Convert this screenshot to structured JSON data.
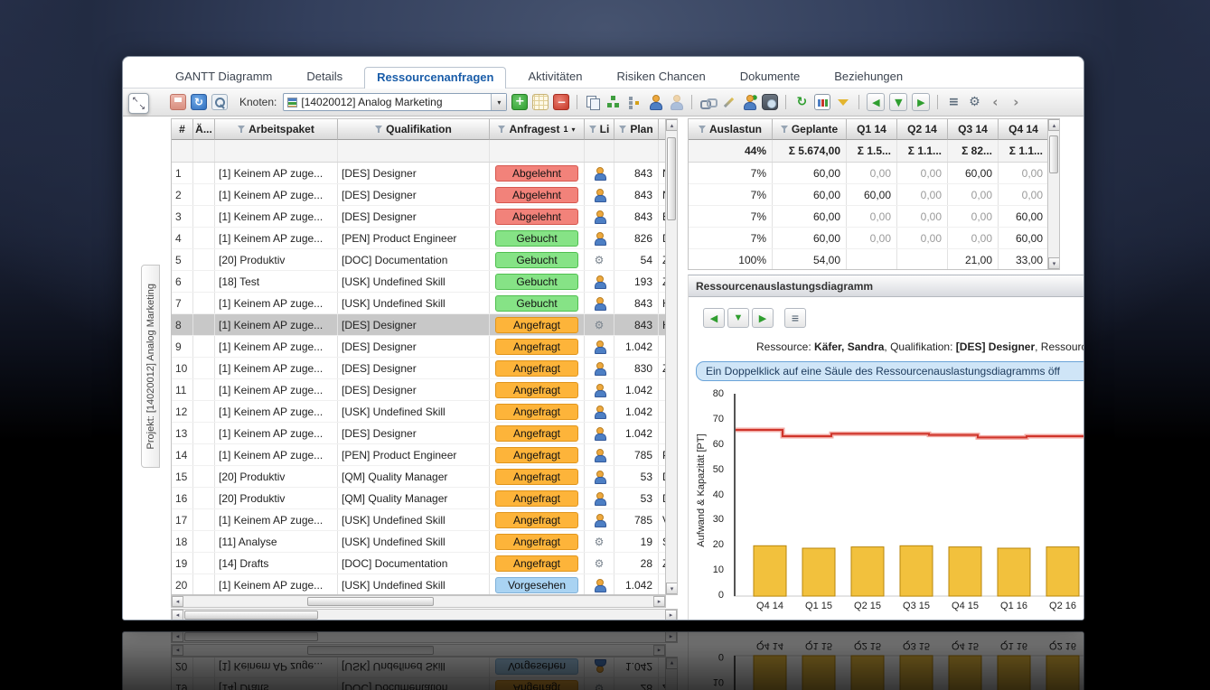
{
  "window": {
    "tabs": [
      {
        "label": "GANTT Diagramm",
        "active": false
      },
      {
        "label": "Details",
        "active": false
      },
      {
        "label": "Ressourcenanfragen",
        "active": true
      },
      {
        "label": "Aktivitäten",
        "active": false
      },
      {
        "label": "Risiken Chancen",
        "active": false
      },
      {
        "label": "Dokumente",
        "active": false
      },
      {
        "label": "Beziehungen",
        "active": false
      }
    ]
  },
  "project_tab": "Projekt: [14020012] Analog Marketing",
  "toolbar": {
    "knoten_label": "Knoten:",
    "node_value": "[14020012] Analog Marketing",
    "icons_left": [
      "save",
      "refresh",
      "zoom"
    ],
    "icons_right": [
      "add",
      "edit-grid",
      "remove",
      "divider",
      "copy",
      "org-tree",
      "tree",
      "person",
      "person-off",
      "divider",
      "link-edit",
      "wand",
      "person-add",
      "camera",
      "divider",
      "redo",
      "chart",
      "funnel",
      "divider",
      "nav-first",
      "nav-down",
      "nav-last",
      "divider",
      "tree-list",
      "gear",
      "overflow-prev",
      "overflow-next"
    ]
  },
  "requests_table": {
    "headers": {
      "num": "#",
      "aend": "Ä...",
      "ap": "Arbeitspaket",
      "qual": "Qualifikation",
      "status": "Anfragest",
      "sort": "1",
      "li": "Li",
      "plan": "Plan"
    },
    "status_colors": {
      "Abgelehnt": {
        "bg": "#f2827a",
        "border": "#d6564e"
      },
      "Gebucht": {
        "bg": "#86e386",
        "border": "#4fbf4f"
      },
      "Angefragt": {
        "bg": "#fdb43a",
        "border": "#e0951c"
      },
      "Vorgesehen": {
        "bg": "#a9d3f2",
        "border": "#7fb0d8"
      }
    },
    "rows": [
      {
        "num": "1",
        "ap": "[1] Keinem AP zuge...",
        "qual": "[DES] Designer",
        "status": "Abgelehnt",
        "icon": "person",
        "plan": "843",
        "extra": "N"
      },
      {
        "num": "2",
        "ap": "[1] Keinem AP zuge...",
        "qual": "[DES] Designer",
        "status": "Abgelehnt",
        "icon": "person",
        "plan": "843",
        "extra": "N"
      },
      {
        "num": "3",
        "ap": "[1] Keinem AP zuge...",
        "qual": "[DES] Designer",
        "status": "Abgelehnt",
        "icon": "person",
        "plan": "843",
        "extra": "E"
      },
      {
        "num": "4",
        "ap": "[1] Keinem AP zuge...",
        "qual": "[PEN] Product Engineer",
        "status": "Gebucht",
        "icon": "person",
        "plan": "826",
        "extra": "D"
      },
      {
        "num": "5",
        "ap": "[20] Produktiv",
        "qual": "[DOC] Documentation",
        "status": "Gebucht",
        "icon": "gear",
        "plan": "54",
        "extra": "Z"
      },
      {
        "num": "6",
        "ap": "[18] Test",
        "qual": "[USK] Undefined Skill",
        "status": "Gebucht",
        "icon": "person",
        "plan": "193",
        "extra": "Z"
      },
      {
        "num": "7",
        "ap": "[1] Keinem AP zuge...",
        "qual": "[USK] Undefined Skill",
        "status": "Gebucht",
        "icon": "person",
        "plan": "843",
        "extra": "H"
      },
      {
        "num": "8",
        "ap": "[1] Keinem AP zuge...",
        "qual": "[DES] Designer",
        "status": "Angefragt",
        "icon": "gear",
        "plan": "843",
        "extra": "H",
        "selected": true
      },
      {
        "num": "9",
        "ap": "[1] Keinem AP zuge...",
        "qual": "[DES] Designer",
        "status": "Angefragt",
        "icon": "person",
        "plan": "1.042",
        "extra": ""
      },
      {
        "num": "10",
        "ap": "[1] Keinem AP zuge...",
        "qual": "[DES] Designer",
        "status": "Angefragt",
        "icon": "person",
        "plan": "830",
        "extra": "Z"
      },
      {
        "num": "11",
        "ap": "[1] Keinem AP zuge...",
        "qual": "[DES] Designer",
        "status": "Angefragt",
        "icon": "person",
        "plan": "1.042",
        "extra": ""
      },
      {
        "num": "12",
        "ap": "[1] Keinem AP zuge...",
        "qual": "[USK] Undefined Skill",
        "status": "Angefragt",
        "icon": "person",
        "plan": "1.042",
        "extra": ""
      },
      {
        "num": "13",
        "ap": "[1] Keinem AP zuge...",
        "qual": "[DES] Designer",
        "status": "Angefragt",
        "icon": "person",
        "plan": "1.042",
        "extra": ""
      },
      {
        "num": "14",
        "ap": "[1] Keinem AP zuge...",
        "qual": "[PEN] Product Engineer",
        "status": "Angefragt",
        "icon": "person",
        "plan": "785",
        "extra": "P"
      },
      {
        "num": "15",
        "ap": "[20] Produktiv",
        "qual": "[QM] Quality Manager",
        "status": "Angefragt",
        "icon": "person",
        "plan": "53",
        "extra": "D"
      },
      {
        "num": "16",
        "ap": "[20] Produktiv",
        "qual": "[QM] Quality Manager",
        "status": "Angefragt",
        "icon": "person",
        "plan": "53",
        "extra": "D"
      },
      {
        "num": "17",
        "ap": "[1] Keinem AP zuge...",
        "qual": "[USK] Undefined Skill",
        "status": "Angefragt",
        "icon": "person",
        "plan": "785",
        "extra": "V"
      },
      {
        "num": "18",
        "ap": "[11] Analyse",
        "qual": "[USK] Undefined Skill",
        "status": "Angefragt",
        "icon": "gear",
        "plan": "19",
        "extra": "S"
      },
      {
        "num": "19",
        "ap": "[14] Drafts",
        "qual": "[DOC] Documentation",
        "status": "Angefragt",
        "icon": "gear",
        "plan": "28",
        "extra": "Z"
      },
      {
        "num": "20",
        "ap": "[1] Keinem AP zuge...",
        "qual": "[USK] Undefined Skill",
        "status": "Vorgesehen",
        "icon": "person",
        "plan": "1.042",
        "extra": ""
      }
    ]
  },
  "allocation_table": {
    "headers": [
      "Auslastun",
      "Geplante",
      "Q1 14",
      "Q2 14",
      "Q3 14",
      "Q4 14"
    ],
    "summary": [
      "44%",
      "Σ 5.674,00",
      "Σ 1.5...",
      "Σ 1.1...",
      "Σ 82...",
      "Σ 1.1..."
    ],
    "rows": [
      [
        "7%",
        "60,00",
        "0,00",
        "0,00",
        "60,00",
        "0,00"
      ],
      [
        "7%",
        "60,00",
        "60,00",
        "0,00",
        "0,00",
        "0,00"
      ],
      [
        "7%",
        "60,00",
        "0,00",
        "0,00",
        "0,00",
        "60,00"
      ],
      [
        "7%",
        "60,00",
        "0,00",
        "0,00",
        "0,00",
        "60,00"
      ],
      [
        "100%",
        "54,00",
        "",
        "",
        "21,00",
        "33,00"
      ]
    ]
  },
  "diagram_panel": {
    "title": "Ressourcenauslastungsdiagramm",
    "resource_line": {
      "label1": "Ressource: ",
      "value1": "Käfer, Sandra",
      "label2": ", Qualifikation: ",
      "value2": "[DES] Designer",
      "tail": ", Ressourc"
    },
    "info_text": "Ein Doppelklick auf eine Säule des Ressourcenauslastungsdiagramms öff"
  },
  "chart_data": {
    "type": "bar",
    "title": "Ressourcenauslastungsdiagramm",
    "categories": [
      "Q4 14",
      "Q1 15",
      "Q2 15",
      "Q3 15",
      "Q4 15",
      "Q1 16",
      "Q2 16"
    ],
    "series": [
      {
        "name": "Aufwand",
        "type": "bar",
        "color": "#f2c13d",
        "values": [
          20,
          19,
          19.5,
          20,
          19.5,
          19,
          19.5
        ]
      },
      {
        "name": "Kapazität",
        "type": "line",
        "color": "#cf352b",
        "values": [
          66,
          63.5,
          64.5,
          64.5,
          64,
          63,
          63.5
        ]
      }
    ],
    "xlabel": "",
    "ylabel": "Aufwand & Kapazität [PT]",
    "ylim": [
      0,
      80
    ],
    "yticks": [
      0,
      10,
      20,
      30,
      40,
      50,
      60,
      70,
      80
    ],
    "grid": false,
    "legend": "none"
  }
}
